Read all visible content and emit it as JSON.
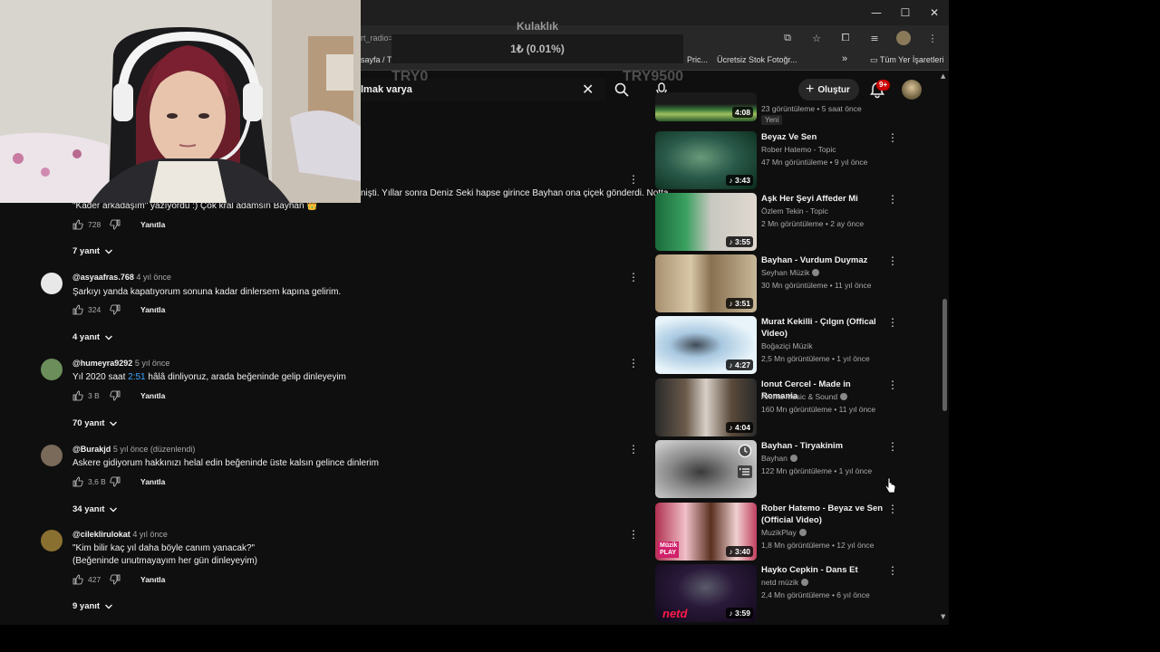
{
  "browser": {
    "url_fragment": "rt_radio=",
    "bookmarks": [
      "sayfa / Tw",
      "Pric...",
      "Ücretsiz Stok Fotoğr...",
      "»",
      "Tüm Yer İşaretleri"
    ],
    "window_controls": {
      "minimize": "—",
      "maximize": "☐",
      "close": "✕"
    }
  },
  "overlay": {
    "title": "Kulaklık",
    "value": "1₺ (0.01%)",
    "min_label": "TRY0",
    "max_label": "TRY9500"
  },
  "header": {
    "search_query": "lmak varya",
    "create_label": "Oluştur",
    "notification_count": "9+"
  },
  "comments_top": {
    "partial_text": "nişti. Yıllar sonra Deniz Seki hapse girince Bayhan ona çiçek gönderdi. Notta",
    "partial_text_2": "\"Kader arkadaşım\" yazıyordu :) Çok kral adamsın Bayhan 👑",
    "likes": "728",
    "reply_label": "Yanıtla",
    "replies": "7 yanıt"
  },
  "comments": [
    {
      "user": "@asyaafras.768",
      "time": "4 yıl önce",
      "lines": [
        "Şarkıyı yanda kapatıyorum sonuna kadar dinlersem kapına gelirim."
      ],
      "likes": "324",
      "reply_label": "Yanıtla",
      "replies": "4 yanıt",
      "avatar_color": "#e8e8e8"
    },
    {
      "user": "@humeyra9292",
      "time": "5 yıl önce",
      "text_before": "Yıl 2020 saat ",
      "link": "2:51",
      "text_after": " hâlâ dinliyoruz, arada beğeninde gelip dinleyeyim",
      "likes": "3 B",
      "reply_label": "Yanıtla",
      "replies": "70 yanıt",
      "avatar_color": "#6b8e5a"
    },
    {
      "user": "@Burakjd",
      "time": "5 yıl önce (düzenlendi)",
      "lines": [
        "Askere gidiyorum hakkınızı helal edin beğeninde üste kalsın gelince dinlerim"
      ],
      "likes": "3,6 B",
      "reply_label": "Yanıtla",
      "replies": "34 yanıt",
      "avatar_color": "#7a6a5a"
    },
    {
      "user": "@cileklirulokat",
      "time": "4 yıl önce",
      "lines": [
        "\"Kim bilir kaç yıl daha böyle canım yanacak?\"",
        "(Beğeninde unutmayayım her gün dinleyeyim)"
      ],
      "likes": "427",
      "reply_label": "Yanıtla",
      "replies": "9 yanıt",
      "avatar_color": "#8a7030"
    }
  ],
  "videos": [
    {
      "title": "",
      "channel": "",
      "meta": "23 görüntüleme • 5 saat önce",
      "duration": "4:08",
      "badge": "Yeni",
      "verified": false
    },
    {
      "title": "Beyaz Ve Sen",
      "channel": "Rober Hatemo - Topic",
      "meta": "47 Mn görüntüleme • 9 yıl önce",
      "duration": "3:43",
      "verified": false
    },
    {
      "title": "Aşk Her Şeyi Affeder Mi",
      "channel": "Özlem Tekin - Topic",
      "meta": "2 Mn görüntüleme • 2 ay önce",
      "duration": "3:55",
      "verified": false
    },
    {
      "title": "Bayhan - Vurdum Duymaz",
      "channel": "Seyhan Müzik",
      "meta": "30 Mn görüntüleme • 11 yıl önce",
      "duration": "3:51",
      "verified": true
    },
    {
      "title": "Murat Kekilli - Çılgın (Offical Video)",
      "channel": "Boğaziçi Müzik",
      "meta": "2,5 Mn görüntüleme • 1 yıl önce",
      "duration": "4:27",
      "verified": false
    },
    {
      "title": "Ionut Cercel - Made in Romania",
      "channel": "Amma Music & Sound",
      "meta": "160 Mn görüntüleme • 11 yıl önce",
      "duration": "4:04",
      "verified": true
    },
    {
      "title": "Bayhan - Tiryakinim",
      "channel": "Bayhan",
      "meta": "122 Mn görüntüleme • 1 yıl önce",
      "duration": "",
      "verified": true
    },
    {
      "title": "Rober Hatemo - Beyaz ve Sen (Official Video)",
      "channel": "MuzikPlay",
      "meta": "1,8 Mn görüntüleme • 12 yıl önce",
      "duration": "3:40",
      "verified": true
    },
    {
      "title": "Hayko Cepkin - Dans Et",
      "channel": "netd müzik",
      "meta": "2,4 Mn görüntüleme • 6 yıl önce",
      "duration": "3:59",
      "verified": true
    }
  ]
}
